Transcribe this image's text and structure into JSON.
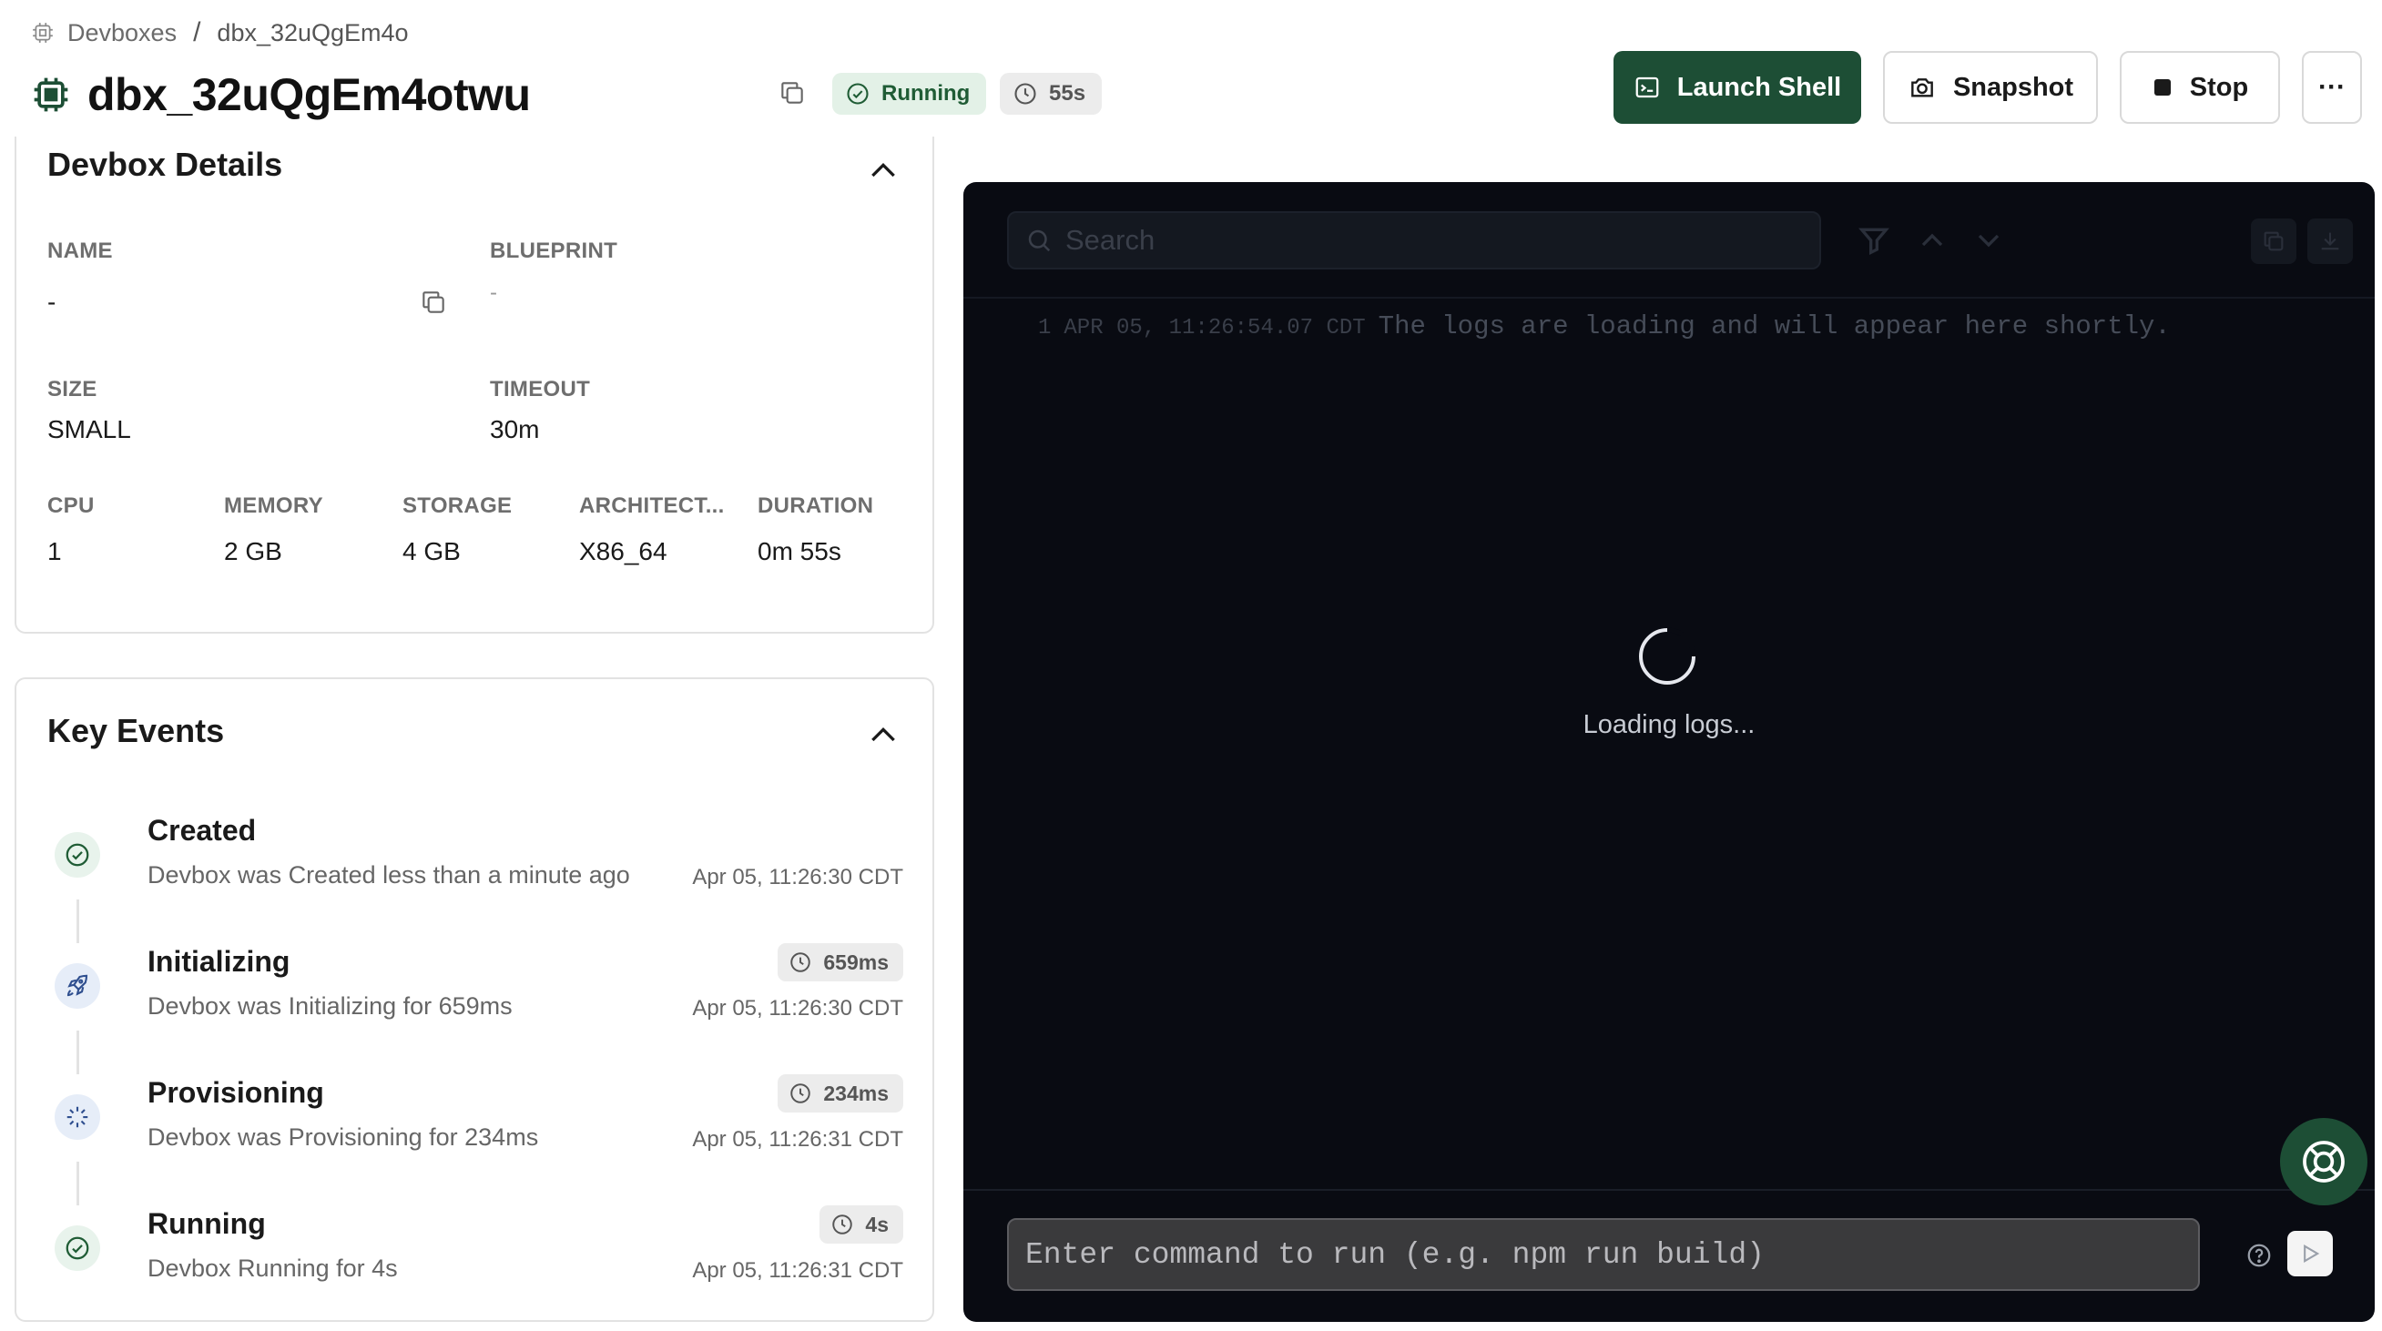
{
  "breadcrumb": {
    "root": "Devboxes",
    "separator": "/",
    "current": "dbx_32uQgEm4o"
  },
  "header": {
    "title": "dbx_32uQgEm4otwu",
    "status": "Running",
    "elapsed": "55s",
    "buttons": {
      "launch_shell": "Launch Shell",
      "snapshot": "Snapshot",
      "stop": "Stop",
      "more": "···"
    }
  },
  "details": {
    "title": "Devbox Details",
    "fields": {
      "name": {
        "label": "NAME",
        "value": "-"
      },
      "blueprint": {
        "label": "BLUEPRINT",
        "value": "-"
      },
      "size": {
        "label": "SIZE",
        "value": "SMALL"
      },
      "timeout": {
        "label": "TIMEOUT",
        "value": "30m"
      },
      "cpu": {
        "label": "CPU",
        "value": "1"
      },
      "memory": {
        "label": "MEMORY",
        "value": "2 GB"
      },
      "storage": {
        "label": "STORAGE",
        "value": "4 GB"
      },
      "architecture": {
        "label": "ARCHITECT...",
        "value": "X86_64"
      },
      "duration": {
        "label": "DURATION",
        "value": "0m 55s"
      }
    }
  },
  "events": {
    "title": "Key Events",
    "items": [
      {
        "name": "Created",
        "description": "Devbox was Created less than a minute ago",
        "time": "Apr 05, 11:26:30 CDT",
        "duration": ""
      },
      {
        "name": "Initializing",
        "description": "Devbox was Initializing for 659ms",
        "time": "Apr 05, 11:26:30 CDT",
        "duration": "659ms"
      },
      {
        "name": "Provisioning",
        "description": "Devbox was Provisioning for 234ms",
        "time": "Apr 05, 11:26:31 CDT",
        "duration": "234ms"
      },
      {
        "name": "Running",
        "description": "Devbox Running for 4s",
        "time": "Apr 05, 11:26:31 CDT",
        "duration": "4s"
      }
    ]
  },
  "logs": {
    "search_placeholder": "Search",
    "line": {
      "number": "1",
      "timestamp": "APR 05, 11:26:54.07 CDT",
      "message": "The logs are loading and will appear here shortly."
    },
    "loading_text": "Loading logs...",
    "command_placeholder": "Enter command to run (e.g. npm run build)"
  },
  "colors": {
    "brand_green": "#1d4e35",
    "running_badge_bg": "#e3f1e7",
    "log_bg": "#090b12"
  }
}
